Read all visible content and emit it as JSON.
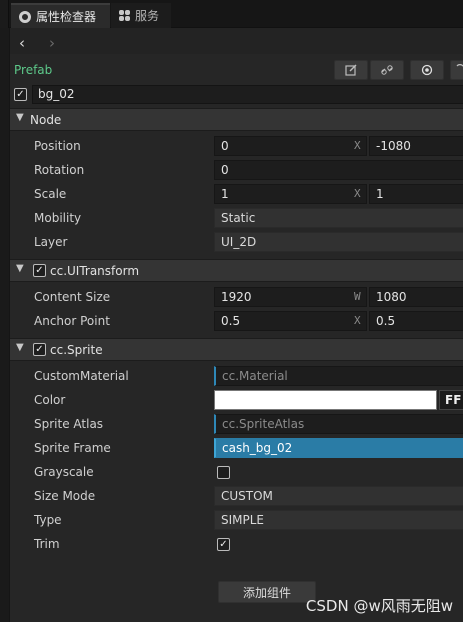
{
  "tabs": [
    {
      "label": "属性检查器",
      "icon": "gear-icon",
      "active": true
    },
    {
      "label": "服务",
      "icon": "grid-icon",
      "active": false
    }
  ],
  "nav": {
    "back": "‹",
    "forward": "›"
  },
  "prefab": {
    "label": "Prefab",
    "actions": [
      "edit-icon",
      "unlink-icon",
      "locate-icon",
      "refresh-icon"
    ]
  },
  "node_name": {
    "checked": true,
    "value": "bg_02"
  },
  "sections": {
    "node": {
      "title": "Node"
    },
    "uitransform": {
      "title": "cc.UITransform",
      "checked": true
    },
    "sprite": {
      "title": "cc.Sprite",
      "checked": true
    }
  },
  "node": {
    "position": {
      "label": "Position",
      "x": "0",
      "x_axis": "X",
      "y": "-1080"
    },
    "rotation": {
      "label": "Rotation",
      "value": "0"
    },
    "scale": {
      "label": "Scale",
      "x": "1",
      "x_axis": "X",
      "y": "1"
    },
    "mobility": {
      "label": "Mobility",
      "value": "Static"
    },
    "layer": {
      "label": "Layer",
      "value": "UI_2D"
    }
  },
  "uitransform": {
    "content_size": {
      "label": "Content Size",
      "w": "1920",
      "w_axis": "W",
      "h": "1080"
    },
    "anchor_point": {
      "label": "Anchor Point",
      "x": "0.5",
      "x_axis": "X",
      "y": "0.5"
    }
  },
  "sprite": {
    "custom_material": {
      "label": "CustomMaterial",
      "value": "cc.Material"
    },
    "color": {
      "label": "Color",
      "swatch": "#ffffff",
      "hex": "FF"
    },
    "sprite_atlas": {
      "label": "Sprite Atlas",
      "value": "cc.SpriteAtlas"
    },
    "sprite_frame": {
      "label": "Sprite Frame",
      "value": "cash_bg_02"
    },
    "grayscale": {
      "label": "Grayscale",
      "checked": false
    },
    "size_mode": {
      "label": "Size Mode",
      "value": "CUSTOM"
    },
    "type": {
      "label": "Type",
      "value": "SIMPLE"
    },
    "trim": {
      "label": "Trim",
      "checked": true
    }
  },
  "add_component": {
    "label": "添加组件"
  },
  "watermark": "CSDN @w风雨无阻w",
  "colors": {
    "prefab": "#5dc98a",
    "asset_accent": "#2e88b8",
    "asset_selected": "#2a7ca6"
  }
}
